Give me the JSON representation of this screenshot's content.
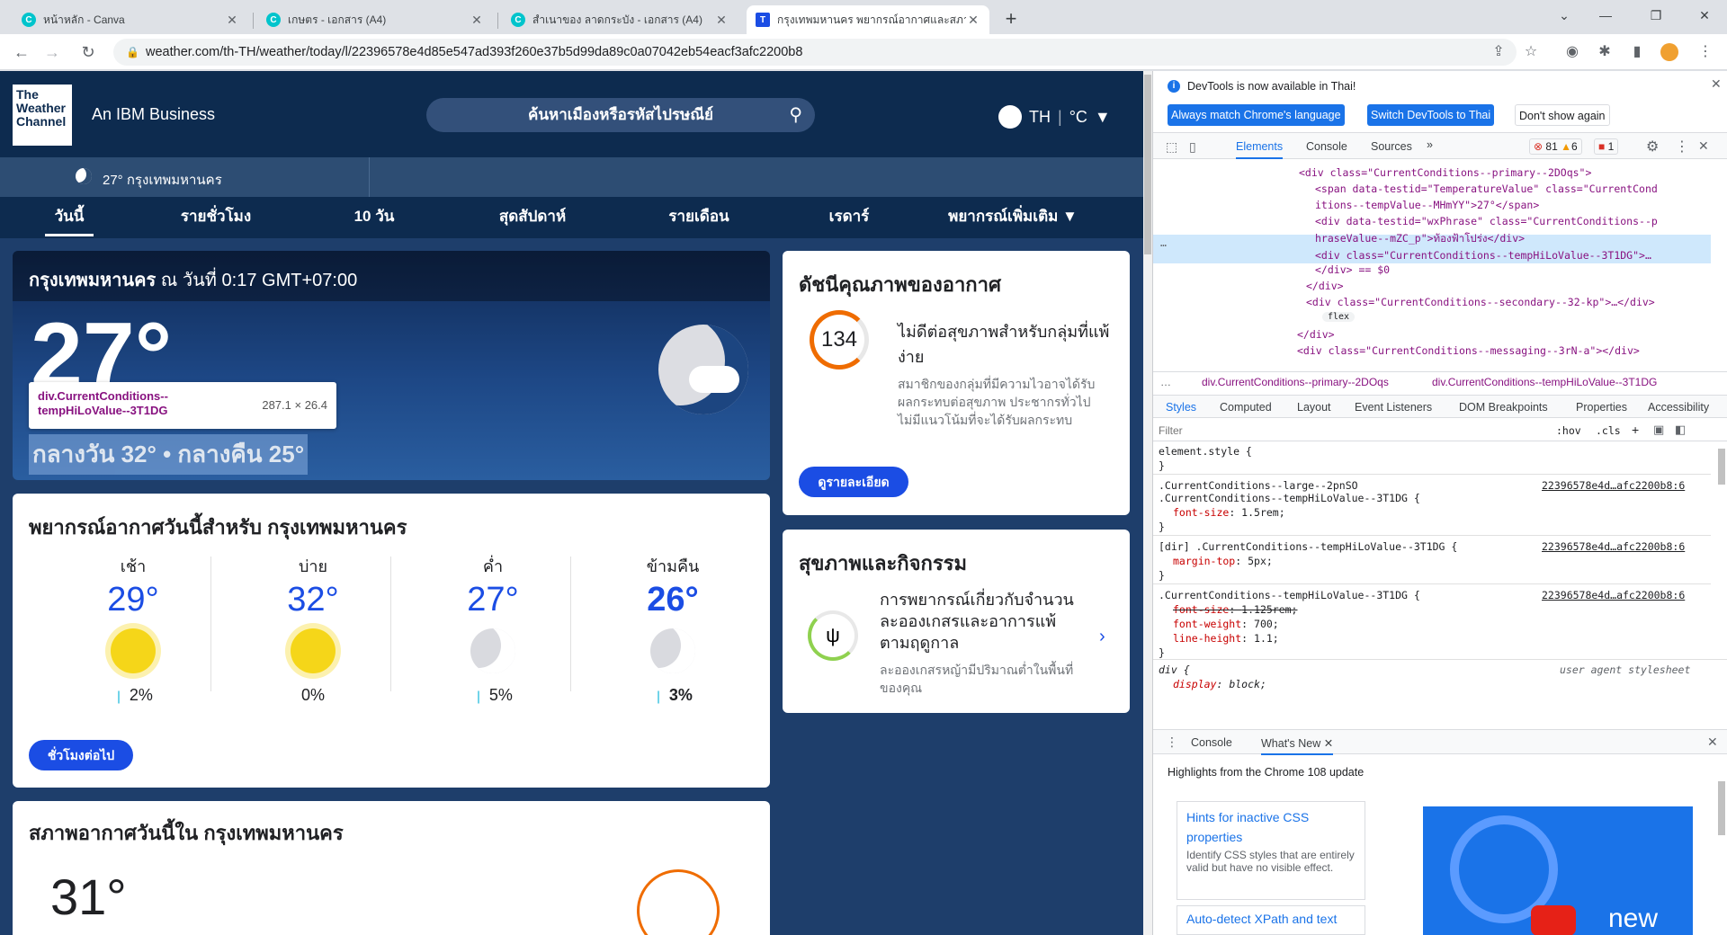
{
  "browser": {
    "tabs": [
      {
        "title": "หน้าหลัก - Canva",
        "icon": "canva-icon"
      },
      {
        "title": "เกษตร - เอกสาร (A4)",
        "icon": "canva-icon"
      },
      {
        "title": "สำเนาของ ลาดกระบัง - เอกสาร (A4)",
        "icon": "canva-icon"
      },
      {
        "title": "กรุงเทพมหานคร พยากรณ์อากาศและสภาพ",
        "icon": "weather-channel-icon"
      }
    ],
    "url": "weather.com/th-TH/weather/today/l/22396578e4d85e547ad393f260e37b5d99da89c0a07042eb54eacf3afc2200b8"
  },
  "site": {
    "logo_lines": [
      "The",
      "Weather",
      "Channel"
    ],
    "tagline": "An IBM Business",
    "search_placeholder": "ค้นหาเมืองหรือรหัสไปรษณีย์",
    "lang": "TH",
    "unit": "°C",
    "current_mini": "27° กรุงเทพมหานคร",
    "nav": [
      "วันนี้",
      "รายชั่วโมง",
      "10 วัน",
      "สุดสัปดาห์",
      "รายเดือน",
      "เรดาร์",
      "พยากรณ์เพิ่มเติม"
    ]
  },
  "current": {
    "city": "กรุงเทพมหานคร",
    "time_prefix": "ณ วันที่",
    "time": "0:17 GMT+07:00",
    "temp": "27°",
    "hilo": "กลางวัน 32° • กลางคืน 25°",
    "tooltip_class": "div.CurrentConditions--tempHiLoValue--3T1DG",
    "tooltip_dim": "287.1 × 26.4"
  },
  "forecast": {
    "title": "พยากรณ์อากาศวันนี้สำหรับ กรุงเทพมหานคร",
    "periods": [
      {
        "label": "เช้า",
        "temp": "29°",
        "precip": "2%",
        "icon": "sun-icon"
      },
      {
        "label": "บ่าย",
        "temp": "32°",
        "precip": "0%",
        "icon": "sun-icon"
      },
      {
        "label": "ค่ำ",
        "temp": "27°",
        "precip": "5%",
        "icon": "moon-stars-icon"
      },
      {
        "label": "ข้ามคืน",
        "temp": "26°",
        "precip": "3%",
        "icon": "moon-stars-icon"
      }
    ],
    "button": "ชั่วโมงต่อไป"
  },
  "aqi": {
    "title": "ดัชนีคุณภาพของอากาศ",
    "value": "134",
    "status": "ไม่ดีต่อสุขภาพสำหรับกลุ่มที่แพ้ง่าย",
    "desc": "สมาชิกของกลุ่มที่มีความไวอาจได้รับผลกระทบต่อสุขภาพ ประชากรทั่วไปไม่มีแนวโน้มที่จะได้รับผลกระทบ",
    "button": "ดูรายละเอียด",
    "accent": "#ef6c00"
  },
  "health": {
    "title": "สุขภาพและกิจกรรม",
    "heading": "การพยากรณ์เกี่ยวกับจำนวนละอองเกสรและอาการแพ้ตามฤดูกาล",
    "desc": "ละอองเกสรหญ้ามีปริมาณต่ำในพื้นที่ของคุณ"
  },
  "today": {
    "title": "สภาพอากาศวันนี้ใน กรุงเทพมหานคร",
    "feels": "31°"
  },
  "devtools": {
    "notice": "DevTools is now available in Thai!",
    "btn_match": "Always match Chrome's language",
    "btn_switch": "Switch DevTools to Thai",
    "btn_dont": "Don't show again",
    "tabs": [
      "Elements",
      "Console",
      "Sources"
    ],
    "errors": "81",
    "warnings": "6",
    "issues": "1",
    "dom_lines": [
      "<div class=\"CurrentConditions--primary--2DOqs\">",
      "<span data-testid=\"TemperatureValue\" class=\"CurrentCond",
      "itions--tempValue--MHmYY\">27°</span>",
      "<div data-testid=\"wxPhrase\" class=\"CurrentConditions--p",
      "hraseValue--mZC_p\">ท้องฟ้าโปร่ง</div>",
      "<div class=\"CurrentConditions--tempHiLoValue--3T1DG\">…",
      "</div> == $0",
      "</div>",
      "<div class=\"CurrentConditions--secondary--32-kp\">…</div>",
      "flex",
      "</div>",
      "<div class=\"CurrentConditions--messaging--3rN-a\"></div>"
    ],
    "breadcrumbs": [
      "div.CurrentConditions--primary--2DOqs",
      "div.CurrentConditions--tempHiLoValue--3T1DG"
    ],
    "subtabs": [
      "Styles",
      "Computed",
      "Layout",
      "Event Listeners",
      "DOM Breakpoints",
      "Properties",
      "Accessibility"
    ],
    "filter_placeholder": "Filter",
    "hov": ":hov",
    "cls": ".cls",
    "styles": [
      {
        "selector": "element.style {",
        "src": "",
        "props": []
      },
      {
        "selector": ".CurrentConditions--large--2pnSO .CurrentConditions--tempHiLoValue--3T1DG {",
        "src": "22396578e4d…afc2200b8:6",
        "props": [
          [
            "font-size",
            "1.5rem;"
          ]
        ]
      },
      {
        "selector": "[dir] .CurrentConditions--tempHiLoValue--3T1DG {",
        "src": "22396578e4d…afc2200b8:6",
        "props": [
          [
            "margin-top",
            "5px;"
          ]
        ]
      },
      {
        "selector": ".CurrentConditions--tempHiLoValue--3T1DG {",
        "src": "22396578e4d…afc2200b8:6",
        "props": [
          [
            "font-size",
            "1.125rem;"
          ],
          [
            "font-weight",
            "700;"
          ],
          [
            "line-height",
            "1.1;"
          ]
        ]
      },
      {
        "selector": "div {",
        "src": "user agent stylesheet",
        "props": [
          [
            "display",
            "block;"
          ]
        ]
      }
    ],
    "drawer_tabs": [
      "Console",
      "What's New"
    ],
    "highlights": "Highlights from the Chrome 108 update",
    "card1_title": "Hints for inactive CSS properties",
    "card1_desc": "Identify CSS styles that are entirely valid but have no visible effect.",
    "card2_title": "Auto-detect XPath and text",
    "video_text": "new"
  }
}
